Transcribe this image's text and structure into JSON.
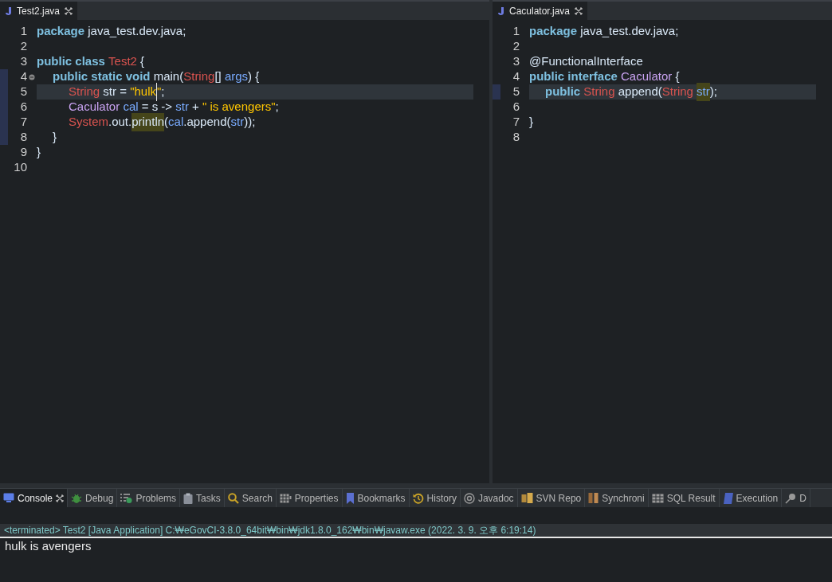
{
  "editors": [
    {
      "tab": {
        "title": "Test2.java",
        "selected": true
      },
      "lines": [
        {
          "number": "1",
          "tokens": [
            {
              "text": "package",
              "kind": "keyword"
            },
            {
              "text": " java_test.dev.java;",
              "kind": "plain"
            }
          ]
        },
        {
          "number": "2"
        },
        {
          "number": "3",
          "tokens": [
            {
              "text": "public class ",
              "kind": "keyword"
            },
            {
              "text": "Test2",
              "kind": "type"
            },
            {
              "text": " {",
              "kind": "plain"
            }
          ],
          "children": [
            {
              "number": "4",
              "expanded": true,
              "changed": true,
              "tokens": [
                {
                  "text": "public static void ",
                  "kind": "keyword"
                },
                {
                  "text": "main(",
                  "kind": "plain"
                },
                {
                  "text": "String",
                  "kind": "type"
                },
                {
                  "text": "[] ",
                  "kind": "plain"
                },
                {
                  "text": "args",
                  "kind": "var"
                },
                {
                  "text": ") {",
                  "kind": "plain"
                }
              ],
              "children": [
                {
                  "number": "5",
                  "selected": true,
                  "changed": true,
                  "tokens": [
                    {
                      "text": "String",
                      "kind": "type"
                    },
                    {
                      "text": " str = ",
                      "kind": "plain"
                    },
                    {
                      "text": "\"hulk",
                      "kind": "string",
                      "caret": true
                    },
                    {
                      "text": "\"",
                      "kind": "string"
                    },
                    {
                      "text": ";",
                      "kind": "plain"
                    }
                  ]
                },
                {
                  "number": "6",
                  "changed": true,
                  "tokens": [
                    {
                      "text": "Caculator ",
                      "kind": "iface"
                    },
                    {
                      "text": "cal",
                      "kind": "var"
                    },
                    {
                      "text": " = s -> ",
                      "kind": "plain"
                    },
                    {
                      "text": "str",
                      "kind": "var"
                    },
                    {
                      "text": " + ",
                      "kind": "plain"
                    },
                    {
                      "text": "\" is avengers\"",
                      "kind": "string"
                    },
                    {
                      "text": ";",
                      "kind": "plain"
                    }
                  ]
                },
                {
                  "number": "7",
                  "changed": true,
                  "tokens": [
                    {
                      "text": "System",
                      "kind": "type"
                    },
                    {
                      "text": ".out.",
                      "kind": "plain"
                    },
                    {
                      "text": "println",
                      "kind": "plain",
                      "highlighted": true
                    },
                    {
                      "text": "(",
                      "kind": "plain"
                    },
                    {
                      "text": "cal",
                      "kind": "var"
                    },
                    {
                      "text": ".append(",
                      "kind": "plain"
                    },
                    {
                      "text": "str",
                      "kind": "var"
                    },
                    {
                      "text": "));",
                      "kind": "plain"
                    }
                  ]
                }
              ]
            },
            {
              "number": "8",
              "changed": true,
              "tokens": [
                {
                  "text": "}",
                  "kind": "plain"
                }
              ]
            }
          ]
        },
        {
          "number": "9",
          "tokens": [
            {
              "text": "}",
              "kind": "plain"
            }
          ]
        },
        {
          "number": "10"
        }
      ]
    },
    {
      "tab": {
        "title": "Caculator.java",
        "selected": true
      },
      "lines": [
        {
          "number": "1",
          "tokens": [
            {
              "text": "package",
              "kind": "keyword"
            },
            {
              "text": " java_test.dev.java;",
              "kind": "plain"
            }
          ]
        },
        {
          "number": "2"
        },
        {
          "number": "3",
          "tokens": [
            {
              "text": "@FunctionalInterface",
              "kind": "plain"
            }
          ]
        },
        {
          "number": "4",
          "tokens": [
            {
              "text": "public interface ",
              "kind": "keyword"
            },
            {
              "text": "Caculator",
              "kind": "iface"
            },
            {
              "text": " {",
              "kind": "plain"
            }
          ],
          "children": [
            {
              "number": "5",
              "selected": true,
              "changed": true,
              "tokens": [
                {
                  "text": "public ",
                  "kind": "keyword"
                },
                {
                  "text": "String",
                  "kind": "type"
                },
                {
                  "text": " append(",
                  "kind": "plain"
                },
                {
                  "text": "String ",
                  "kind": "type"
                },
                {
                  "text": "str",
                  "kind": "var",
                  "highlighted": true
                },
                {
                  "text": ");",
                  "kind": "plain"
                }
              ]
            }
          ]
        },
        {
          "number": "6"
        },
        {
          "number": "7",
          "tokens": [
            {
              "text": "}",
              "kind": "plain"
            }
          ]
        },
        {
          "number": "8"
        }
      ]
    }
  ],
  "views": [
    {
      "label": "Console",
      "selected": true,
      "closable": true
    },
    {
      "label": "Debug",
      "selected": false
    },
    {
      "label": "Problems",
      "selected": false
    },
    {
      "label": "Tasks",
      "selected": false
    },
    {
      "label": "Search",
      "selected": false
    },
    {
      "label": "Properties",
      "selected": false
    },
    {
      "label": "Bookmarks",
      "selected": false
    },
    {
      "label": "History",
      "selected": false
    },
    {
      "label": "Javadoc",
      "selected": false
    },
    {
      "label": "SVN Repo",
      "selected": false
    },
    {
      "label": "Synchroni",
      "selected": false
    },
    {
      "label": "SQL Result",
      "selected": false
    },
    {
      "label": "Execution",
      "selected": false
    },
    {
      "label": "D",
      "selected": false
    }
  ],
  "console": {
    "header": "<terminated> Test2 [Java Application] C:₩eGovCI-3.8.0_64bit₩bin₩jdk1.8.0_162₩bin₩javaw.exe (2022. 3. 9. 오후 6:19:14)",
    "output": [
      "hulk is avengers"
    ]
  }
}
